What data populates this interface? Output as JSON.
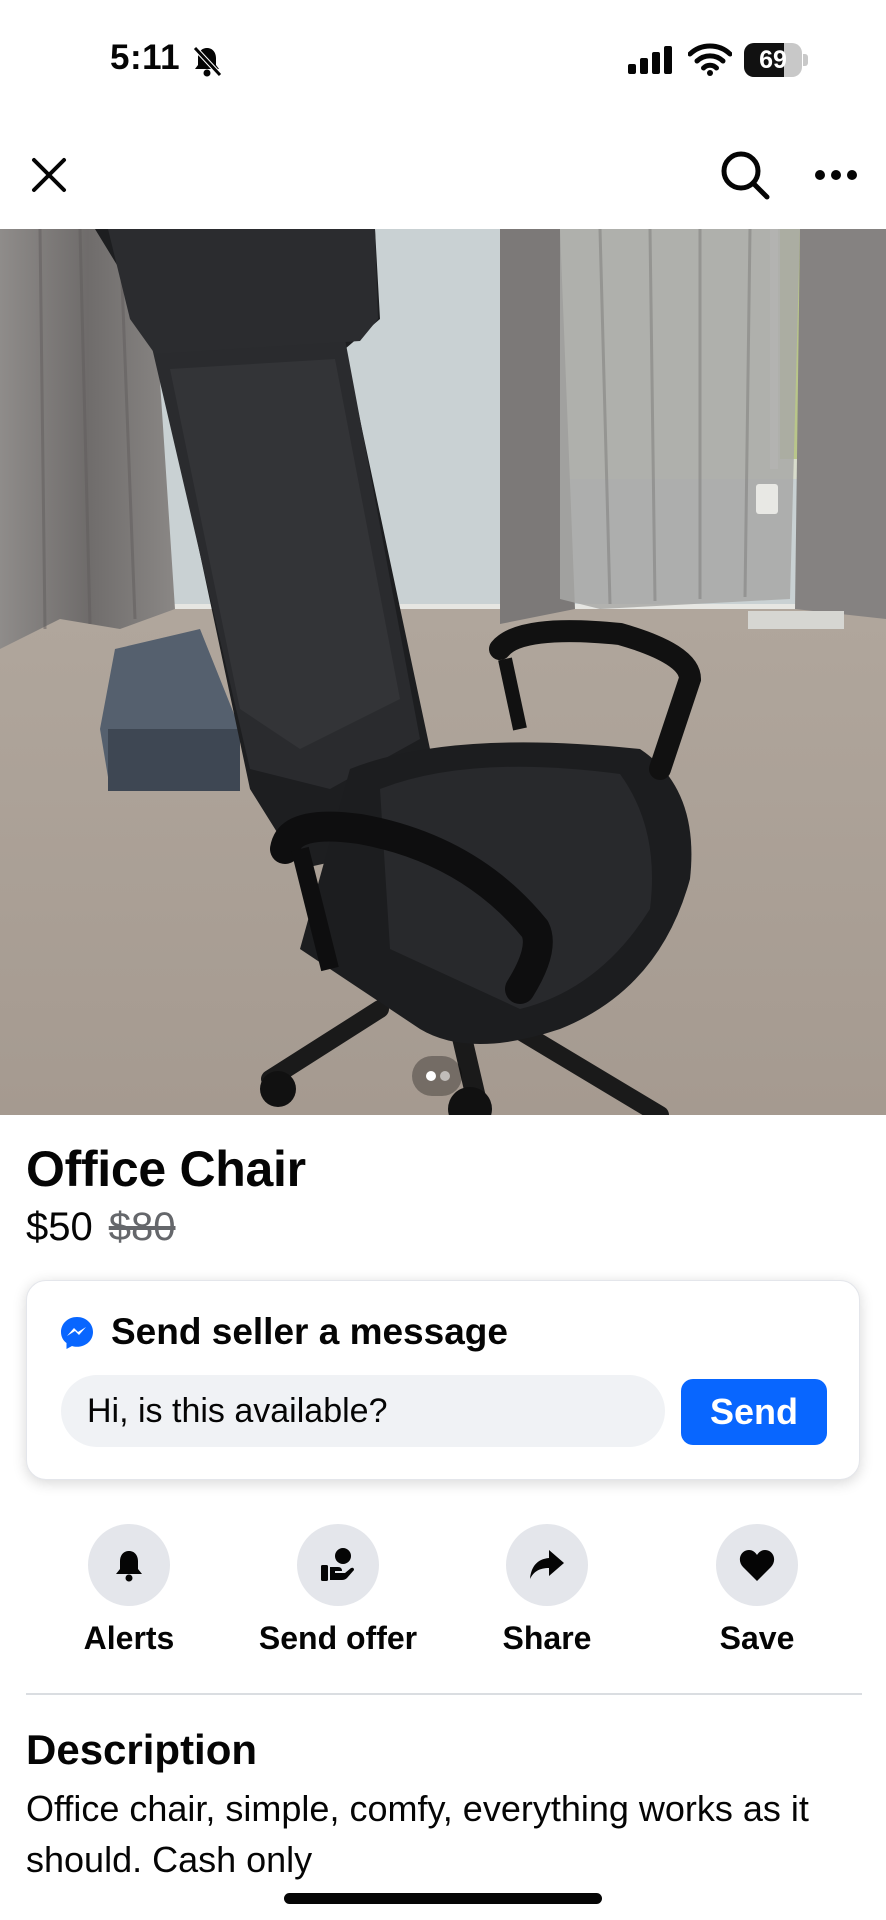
{
  "status_bar": {
    "time": "5:11",
    "battery_level": 69,
    "battery_text": "69",
    "silent_icon": "bell-slash-icon",
    "signal_icon": "cellular-signal-icon",
    "wifi_icon": "wifi-icon"
  },
  "nav": {
    "close_icon": "close-icon",
    "search_icon": "search-icon",
    "more_icon": "more-horizontal-icon"
  },
  "photo": {
    "description_icon": "listing-photo",
    "page_count": 2,
    "current_page": 1
  },
  "listing": {
    "title": "Office Chair",
    "price": "$50",
    "original_price": "$80"
  },
  "message": {
    "heading": "Send seller a message",
    "input_value": "Hi, is this available?",
    "send_label": "Send",
    "icon": "messenger-icon",
    "accent_color": "#0866ff"
  },
  "actions": [
    {
      "label": "Alerts",
      "icon": "bell-icon"
    },
    {
      "label": "Send offer",
      "icon": "send-offer-icon"
    },
    {
      "label": "Share",
      "icon": "share-icon"
    },
    {
      "label": "Save",
      "icon": "heart-icon"
    }
  ],
  "description": {
    "title": "Description",
    "text": "Office chair, simple, comfy, everything works as it should. Cash only"
  }
}
